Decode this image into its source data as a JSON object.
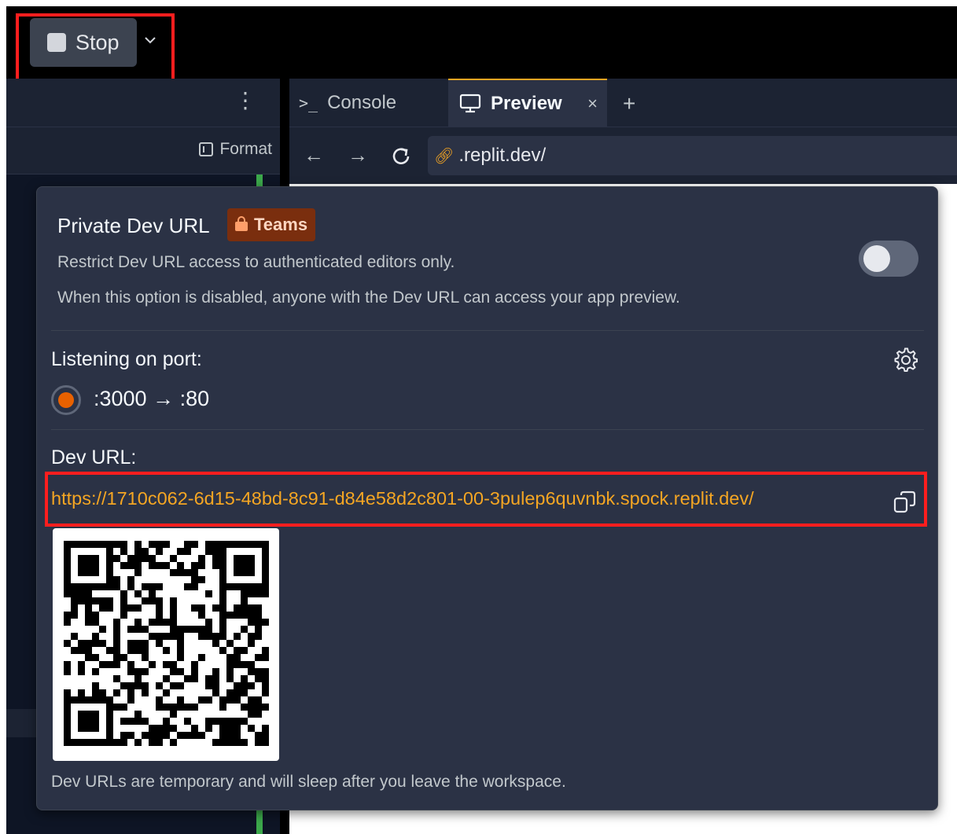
{
  "toolbar": {
    "stop_label": "Stop"
  },
  "left_panel": {
    "format_label": "Format"
  },
  "tabs": [
    {
      "label": "Console",
      "glyph": ">_"
    },
    {
      "label": "Preview",
      "close": "×"
    }
  ],
  "tab_add": "+",
  "browser": {
    "url": ".replit.dev/"
  },
  "popover": {
    "title": "Private Dev URL",
    "badge": "Teams",
    "description_1": "Restrict Dev URL access to authenticated editors only.",
    "description_2": "When this option is disabled, anyone with the Dev URL can access your app preview.",
    "toggle_on": false,
    "port_label": "Listening on port:",
    "port_value": ":3000 → :80",
    "dev_url_label": "Dev URL:",
    "dev_url": "https://1710c062-6d15-48bd-8c91-d84e58d2c801-00-3pulep6quvnbk.spock.replit.dev/",
    "footer": "Dev URLs are temporary and will sleep after you leave the workspace."
  },
  "colors": {
    "accent": "#f5a623",
    "highlight": "#ff1e1e",
    "radio": "#e86100",
    "badge_bg": "#7a2e0e"
  }
}
